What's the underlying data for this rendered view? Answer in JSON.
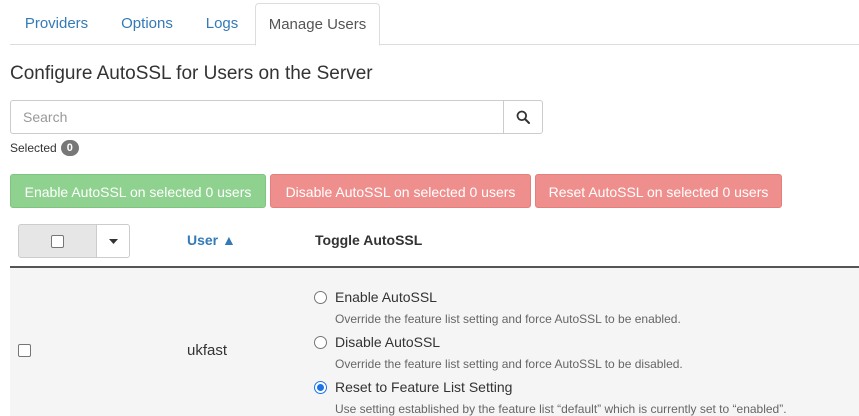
{
  "tabs": [
    {
      "label": "Providers",
      "active": false
    },
    {
      "label": "Options",
      "active": false
    },
    {
      "label": "Logs",
      "active": false
    },
    {
      "label": "Manage Users",
      "active": true
    }
  ],
  "page_title": "Configure AutoSSL for Users on the Server",
  "search": {
    "placeholder": "Search",
    "value": "",
    "icon": "search-icon"
  },
  "selected": {
    "label": "Selected",
    "count": "0"
  },
  "actions": {
    "enable": "Enable AutoSSL on selected 0 users",
    "disable": "Disable AutoSSL on selected 0 users",
    "reset": "Reset AutoSSL on selected 0 users"
  },
  "colors": {
    "link": "#337ab7",
    "enable_btn": "#8fd18f",
    "danger_btn": "#ef8f8d",
    "radio_selected": "#1a73e8"
  },
  "table": {
    "headers": {
      "user": "User ▲",
      "toggle": "Toggle AutoSSL"
    },
    "rows": [
      {
        "user": "ukfast",
        "checked": false,
        "options": [
          {
            "label": "Enable AutoSSL",
            "description": "Override the feature list setting and force AutoSSL to be enabled.",
            "selected": false
          },
          {
            "label": "Disable AutoSSL",
            "description": "Override the feature list setting and force AutoSSL to be disabled.",
            "selected": false
          },
          {
            "label": "Reset to Feature List Setting",
            "description": "Use setting established by the feature list “default” which is currently set to “enabled”.",
            "selected": true
          }
        ]
      }
    ]
  }
}
